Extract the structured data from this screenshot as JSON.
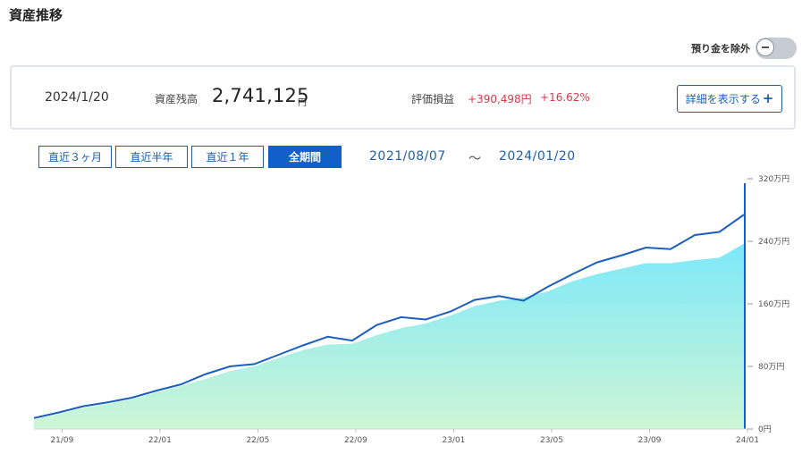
{
  "page": {
    "title": "資産推移"
  },
  "toggle": {
    "label": "預り金を除外"
  },
  "summary": {
    "date": "2024/1/20",
    "balance_label": "資産残高",
    "balance": "2,741,125",
    "balance_unit": "円",
    "pl_label": "評価損益",
    "pl_value": "+390,498円",
    "pl_percent": "+16.62%",
    "detail_button": "詳細を表示する"
  },
  "ranges": {
    "items": [
      "直近３ヶ月",
      "直近半年",
      "直近１年",
      "全期間"
    ],
    "active": "全期間"
  },
  "period": {
    "start": "2021/08/07",
    "separator": "～",
    "end": "2024/01/20"
  },
  "colors": {
    "accent": "#1160c9",
    "line": "#1c5fbf",
    "area_top": "#7de8f8",
    "area_bottom": "#cdf6d6",
    "gain": "#d73a49"
  },
  "chart_data": {
    "type": "area",
    "x_tick_labels": [
      "21/09",
      "22/01",
      "22/05",
      "22/09",
      "23/01",
      "23/05",
      "23/09",
      "24/01"
    ],
    "y_tick_labels": [
      "0円",
      "80万円",
      "160万円",
      "240万円",
      "320万円"
    ],
    "ylim": [
      0,
      320
    ],
    "y_unit": "万円",
    "x": [
      "21/08",
      "21/09",
      "21/10",
      "21/11",
      "21/12",
      "22/01",
      "22/02",
      "22/03",
      "22/04",
      "22/05",
      "22/06",
      "22/07",
      "22/08",
      "22/09",
      "22/10",
      "22/11",
      "22/12",
      "23/01",
      "23/02",
      "23/03",
      "23/04",
      "23/05",
      "23/06",
      "23/07",
      "23/08",
      "23/09",
      "23/10",
      "23/11",
      "23/12",
      "24/01"
    ],
    "series": [
      {
        "kind": "line",
        "values": [
          14,
          21,
          29,
          34,
          40,
          49,
          57,
          70,
          80,
          83,
          95,
          107,
          118,
          113,
          133,
          143,
          140,
          150,
          165,
          170,
          164,
          182,
          198,
          213,
          222,
          232,
          230,
          248,
          252,
          274
        ]
      },
      {
        "kind": "area",
        "values": [
          12,
          19,
          27,
          32,
          38,
          47,
          55,
          64,
          74,
          80,
          91,
          101,
          108,
          109,
          120,
          129,
          135,
          145,
          157,
          164,
          168,
          176,
          189,
          198,
          205,
          212,
          212,
          216,
          219,
          237
        ]
      }
    ]
  }
}
